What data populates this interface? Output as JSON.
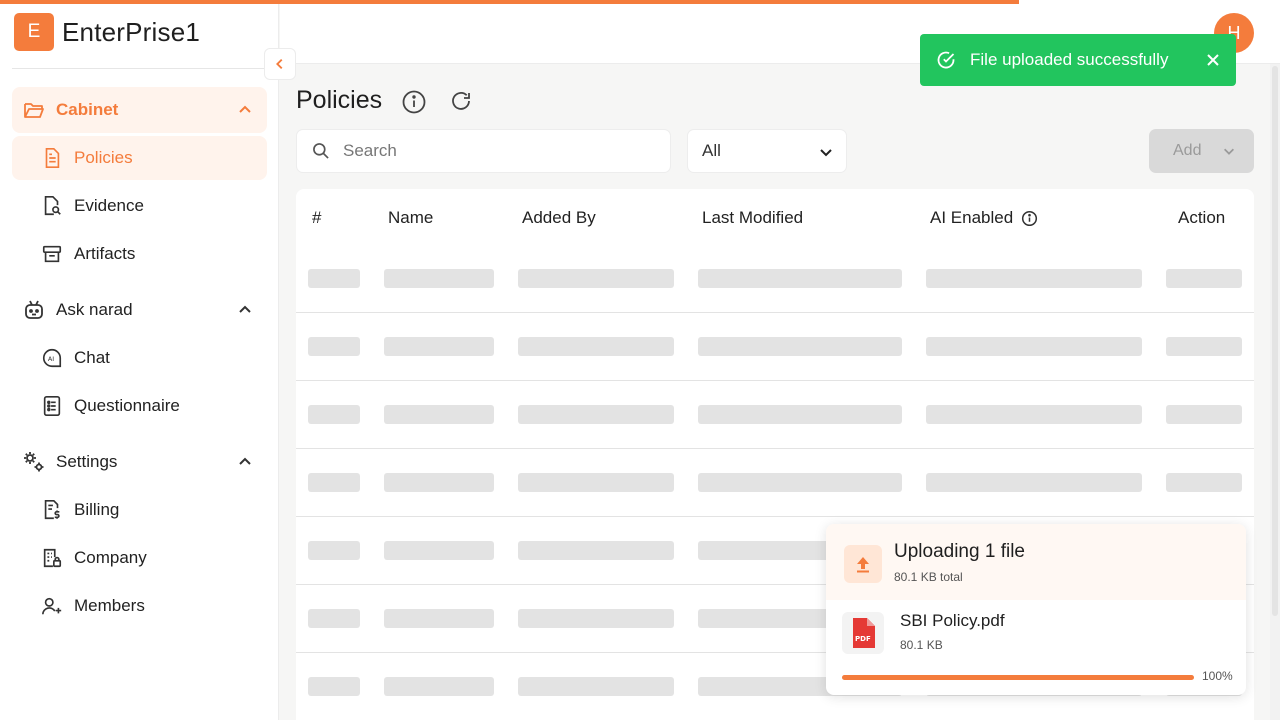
{
  "brand": {
    "logo_letter": "E",
    "name": "EnterPrise1"
  },
  "sidebar": {
    "groups": [
      {
        "label": "Cabinet",
        "items": [
          {
            "label": "Policies"
          },
          {
            "label": "Evidence"
          },
          {
            "label": "Artifacts"
          }
        ]
      },
      {
        "label": "Ask narad",
        "items": [
          {
            "label": "Chat"
          },
          {
            "label": "Questionnaire"
          }
        ]
      },
      {
        "label": "Settings",
        "items": [
          {
            "label": "Billing"
          },
          {
            "label": "Company"
          },
          {
            "label": "Members"
          }
        ]
      }
    ]
  },
  "header": {
    "avatar_letter": "H"
  },
  "page": {
    "title": "Policies"
  },
  "search": {
    "placeholder": "Search"
  },
  "filter": {
    "selected": "All"
  },
  "toolbar": {
    "add_label": "Add"
  },
  "table": {
    "columns": [
      "#",
      "Name",
      "Added By",
      "Last Modified",
      "AI Enabled",
      "Action"
    ],
    "state": "loading"
  },
  "toast": {
    "message": "File uploaded successfully"
  },
  "upload": {
    "title": "Uploading 1 file",
    "total": "80.1 KB total",
    "file": {
      "name": "SBI Policy.pdf",
      "size": "80.1 KB",
      "type": "PDF"
    },
    "progress_percent": 100,
    "progress_label": "100%"
  },
  "colors": {
    "accent": "#f47c3c",
    "success": "#22c55e",
    "skeleton": "#e3e3e3"
  },
  "page_load_progress_percent": 79.6
}
